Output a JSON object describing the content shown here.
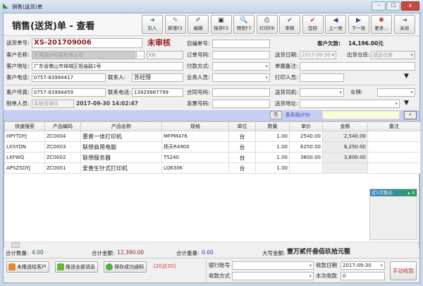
{
  "window": {
    "title": "销售(送货)单",
    "controls": [
      "minimize",
      "maximize",
      "close"
    ]
  },
  "header": {
    "title": "销售(送货)单 - 查看"
  },
  "toolbar": [
    {
      "label": "引入",
      "icon": "import-arrow-icon"
    },
    {
      "label": "新增F2",
      "icon": "new-icon"
    },
    {
      "label": "编辑",
      "icon": "edit-icon"
    },
    {
      "label": "保存F3",
      "icon": "save-icon"
    },
    {
      "label": "预览F7",
      "icon": "preview-icon"
    },
    {
      "label": "打印F8",
      "icon": "print-icon"
    },
    {
      "label": "审核",
      "icon": "check-icon"
    },
    {
      "label": "签回",
      "icon": "signback-icon"
    },
    {
      "label": "上一张",
      "icon": "prev-icon"
    },
    {
      "label": "下一张",
      "icon": "next-icon"
    },
    {
      "label": "更多...",
      "icon": "more-icon"
    },
    {
      "label": "关闭",
      "icon": "exit-icon"
    }
  ],
  "form": {
    "order_no_label": "送货单号:",
    "order_no": "XS-201709006",
    "status": "未审核",
    "custom_no_label": "自编单号:",
    "custom_no": "",
    "debt_label": "客户欠款:",
    "debt": "14,196.00元",
    "customer_label": "客户名称:",
    "customer": "开博瑞尔科技有限公司",
    "customer_code": "KB",
    "order_ref_label": "订单号码:",
    "order_ref": "",
    "delivery_date_label": "送货日期:",
    "delivery_date": "2017-09-30",
    "warehouse_label": "出货仓库:",
    "warehouse": "成品仓库",
    "address_label": "客户地址:",
    "address": "广东省佛山市禅城区祖庙路1号",
    "payment_label": "付款方式:",
    "payment": "",
    "remark_label": "单据备注:",
    "remark": "",
    "phone_label": "客户电话:",
    "phone": "0757-83994417",
    "contact_label": "联系人:",
    "contact": "苏经理",
    "salesman_label": "业务人员:",
    "salesman": "",
    "printer_label": "打印人员:",
    "printer": "",
    "fax_label": "客户传真:",
    "fax": "0757-83994459",
    "contact_phone_label": "联系电话:",
    "contact_phone": "13929987799",
    "contract_label": "合同号码:",
    "contract": "",
    "driver_label": "送货司机:",
    "driver": "",
    "plate_label": "车牌:",
    "plate": "",
    "creator_label": "制单人员:",
    "creator": "系统管理员",
    "created_at": "2017-09-30 14:02:47",
    "invoice_label": "发票号码:",
    "invoice": "",
    "ship_addr_label": "送货地址:",
    "ship_addr": ""
  },
  "barcode": {
    "label": "条形码(F9)",
    "value": ""
  },
  "grid": {
    "columns": [
      "快速搜索",
      "产品编码",
      "产品名称",
      "规格",
      "单位",
      "数量",
      "单价",
      "金额",
      "备注"
    ],
    "rows": [
      [
        "HPYTDYJ",
        "ZC0004",
        "惠普一体打印机",
        "MFPM476",
        "台",
        "1.00",
        "2540.00",
        "2,540.00",
        ""
      ],
      [
        "LXSYDN",
        "ZC0003",
        "联想商用电脑",
        "扬天R4900",
        "台",
        "1.00",
        "6250.00",
        "6,250.00",
        ""
      ],
      [
        "LXFWQ",
        "ZC0002",
        "联想服务器",
        "TS240",
        "台",
        "1.00",
        "3600.00",
        "3,600.00",
        ""
      ],
      [
        "APSZSDYJ",
        "ZC0001",
        "爱普生针式打印机",
        "LQ630K",
        "台",
        "1.00",
        "",
        ""
      ]
    ]
  },
  "price_panel": {
    "title": "近5次售价"
  },
  "totals": {
    "qty_label": "合计数量:",
    "qty": "4.00",
    "amount_label": "合计金额:",
    "amount": "12,390.00",
    "weight_label": "合计重量:",
    "weight": "0.00",
    "caps_label": "大写金额:",
    "caps": "壹万贰仟叁佰玖拾元整"
  },
  "bottom": {
    "btn_unsent": "未推送给客户",
    "btn_push_all": "推送全部消息",
    "btn_save_notify": "保存成功通知",
    "counter": "[20]/[20]",
    "bank_label": "银行账号",
    "bank": "",
    "pay_method_label": "收款方式",
    "pay_method": "",
    "receipt_date_label": "收款日期",
    "receipt_date": "2017-09-30",
    "this_receipt_label": "本次收款",
    "this_receipt": "0",
    "manual_btn": "手动收款"
  }
}
